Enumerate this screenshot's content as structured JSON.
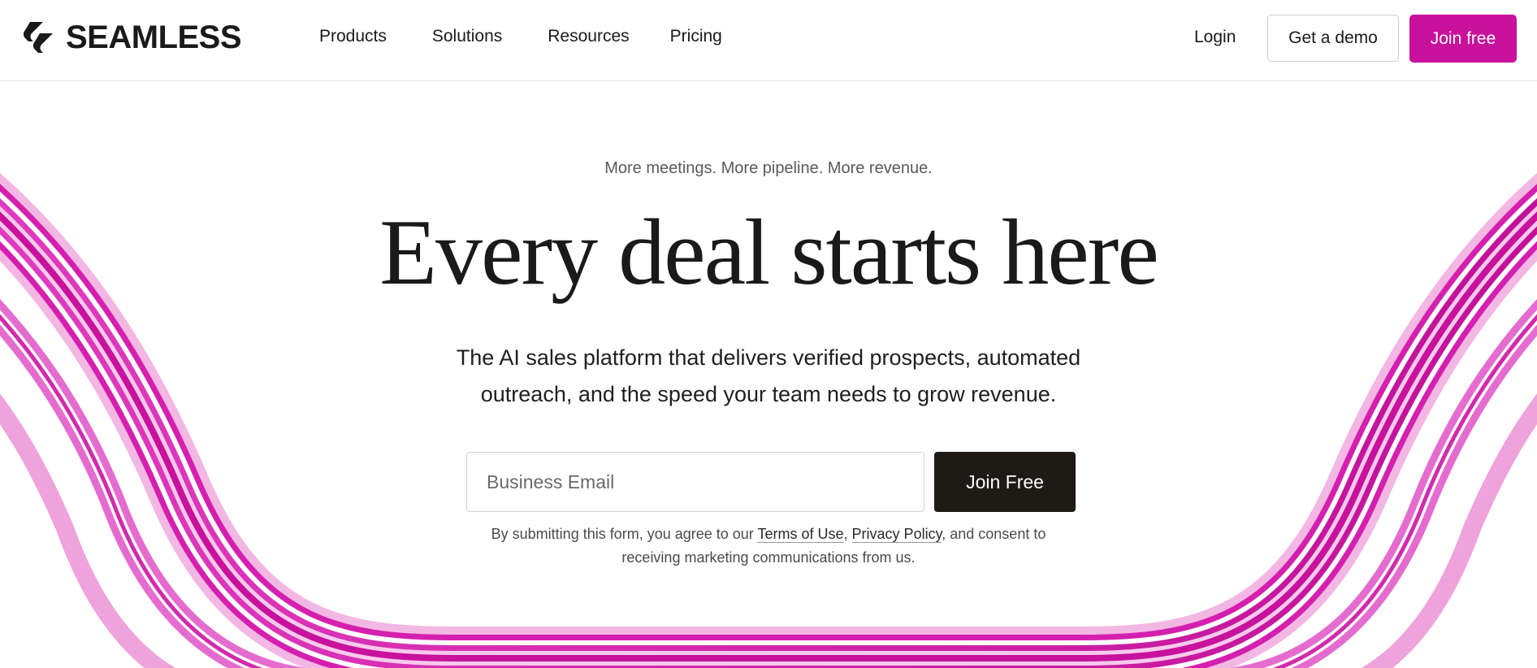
{
  "brand": {
    "name": "SEAMLESS",
    "accent_color": "#c8119c",
    "dark_color": "#1e1b16"
  },
  "nav": {
    "items": [
      {
        "label": "Products"
      },
      {
        "label": "Solutions"
      },
      {
        "label": "Resources"
      },
      {
        "label": "Pricing"
      }
    ],
    "login_label": "Login",
    "demo_label": "Get a demo",
    "join_label": "Join free"
  },
  "hero": {
    "tagline": "More meetings. More pipeline. More revenue.",
    "headline": "Every deal starts here",
    "subtext_line1": "The AI sales platform that delivers verified prospects, automated",
    "subtext_line2": "outreach, and the speed your team needs to grow revenue.",
    "email_placeholder": "Business Email",
    "email_value": "",
    "submit_label": "Join Free",
    "legal": {
      "prefix": "By submitting this form, you agree to our ",
      "terms_label": "Terms of Use",
      "comma": ",",
      "privacy_label": "Privacy Policy",
      "suffix_line1": ", and consent to",
      "line2": "receiving marketing communications from us."
    }
  },
  "icons": {
    "logo_mark": "seamless-logo-icon"
  }
}
